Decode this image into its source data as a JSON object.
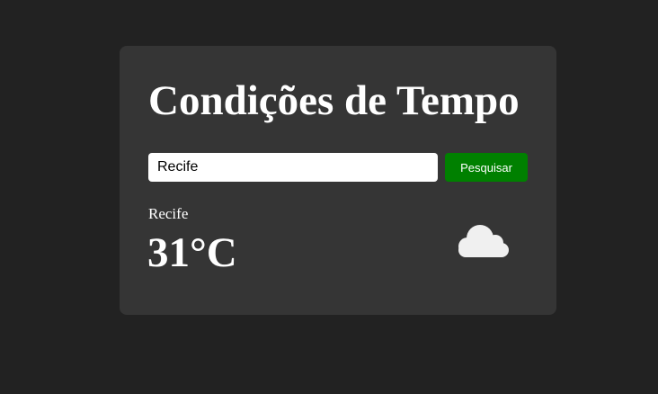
{
  "weather": {
    "title": "Condições de Tempo",
    "search": {
      "value": "Recife",
      "button_label": "Pesquisar"
    },
    "result": {
      "city": "Recife",
      "temperature": "31°C",
      "icon": "cloud-icon"
    }
  },
  "colors": {
    "page_background": "#222222",
    "card_background": "#353535",
    "button_background": "#008000",
    "text": "#ffffff",
    "icon": "#f0f0f0"
  }
}
